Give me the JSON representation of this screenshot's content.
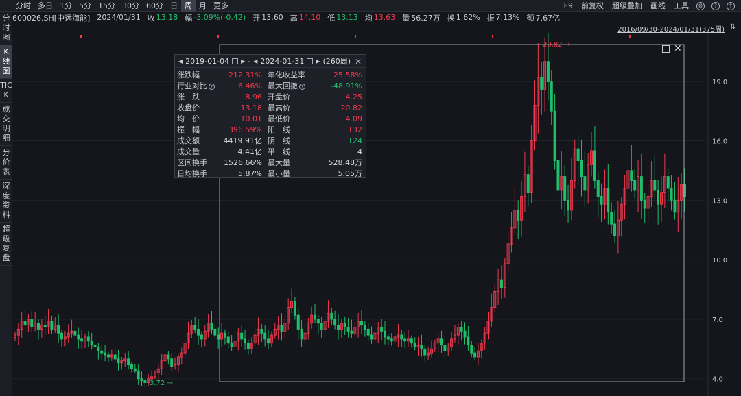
{
  "toolbar": {
    "periods": [
      "分时",
      "多日",
      "1分",
      "5分",
      "15分",
      "30分",
      "60分",
      "日",
      "周",
      "月",
      "更多"
    ],
    "active_period": "周",
    "right": [
      "F9",
      "前复权",
      "超级叠加",
      "画线",
      "工具"
    ]
  },
  "sidebar": {
    "items": [
      "分时图",
      "K线图",
      "TICK",
      "成交明细",
      "分价表",
      "深度资料",
      "超级复盘"
    ],
    "active": "K线图"
  },
  "info": {
    "code": "600026.SH[中远海能]",
    "date": "2024/01/31",
    "close_label": "收",
    "close": "13.18",
    "change_label": "幅",
    "change": "-3.09%(-0.42)",
    "open_label": "开",
    "open": "13.60",
    "high_label": "高",
    "high": "14.10",
    "low_label": "低",
    "low": "13.13",
    "avg_label": "均",
    "avg": "13.63",
    "vol_label": "量",
    "vol": "56.27万",
    "turn_label": "换",
    "turn": "1.62%",
    "amp_label": "振",
    "amp": "7.13%",
    "amt_label": "额",
    "amt": "7.67亿"
  },
  "range_text": "2016/09/30-2024/01/31(375周)",
  "stats": {
    "start_date": "2019-01-04",
    "dash": "-",
    "end_date": "2024-01-31",
    "weeks": "(260周)",
    "rows": [
      {
        "k1": "涨跌幅",
        "v1": "212.31%",
        "c1": "up",
        "k2": "年化收益率",
        "v2": "25.58%",
        "c2": "up"
      },
      {
        "k1": "行业对比",
        "v1": "6.46%",
        "c1": "up",
        "k2": "最大回撤",
        "v2": "-48.91%",
        "c2": "down",
        "h1": true,
        "h2": true
      },
      {
        "k1": "涨　跌",
        "v1": "8.96",
        "c1": "up",
        "k2": "开盘价",
        "v2": "4.25",
        "c2": "up"
      },
      {
        "k1": "收盘价",
        "v1": "13.18",
        "c1": "up",
        "k2": "最高价",
        "v2": "20.82",
        "c2": "up"
      },
      {
        "k1": "均　价",
        "v1": "10.01",
        "c1": "up",
        "k2": "最低价",
        "v2": "4.09",
        "c2": "up"
      },
      {
        "k1": "振　幅",
        "v1": "396.59%",
        "c1": "up",
        "k2": "阳　线",
        "v2": "132",
        "c2": "up"
      },
      {
        "k1": "成交额",
        "v1": "4419.91亿",
        "c1": "neutral",
        "k2": "阴　线",
        "v2": "124",
        "c2": "down"
      },
      {
        "k1": "成交量",
        "v1": "4.41亿",
        "c1": "neutral",
        "k2": "平　线",
        "v2": "4",
        "c2": "neutral"
      },
      {
        "k1": "区间换手",
        "v1": "1526.66%",
        "c1": "neutral",
        "k2": "最大量",
        "v2": "528.48万",
        "c2": "neutral"
      },
      {
        "k1": "日均换手",
        "v1": "5.87%",
        "c1": "neutral",
        "k2": "最小量",
        "v2": "5.05万",
        "c2": "neutral"
      }
    ]
  },
  "colors": {
    "up": "#f0394f",
    "down": "#1fbf6c",
    "bg": "#14161b"
  },
  "chart_data": {
    "type": "candlestick",
    "y_ticks": [
      "19.0",
      "16.0",
      "13.0",
      "10.0",
      "7.0",
      "4.0"
    ],
    "ylim": [
      3.3,
      21.1
    ],
    "high_marker": "20.82",
    "low_marker": "3.72",
    "close_path": [
      6.2,
      6.5,
      6.9,
      6.7,
      7.0,
      6.6,
      6.8,
      6.5,
      6.7,
      6.6,
      6.9,
      6.5,
      6.7,
      6.3,
      6.0,
      6.1,
      6.3,
      6.4,
      6.2,
      6.0,
      5.9,
      6.1,
      5.9,
      5.7,
      5.6,
      5.4,
      5.3,
      5.2,
      5.1,
      5.2,
      5.0,
      4.8,
      4.9,
      5.0,
      4.7,
      4.5,
      4.4,
      4.0,
      3.9,
      3.8,
      4.0,
      4.1,
      4.3,
      4.5,
      4.9,
      5.2,
      5.0,
      4.6,
      4.7,
      5.1,
      5.3,
      5.8,
      6.3,
      6.7,
      6.5,
      6.2,
      6.0,
      6.4,
      6.8,
      6.5,
      6.2,
      6.0,
      6.3,
      6.1,
      5.8,
      5.6,
      5.9,
      6.3,
      6.0,
      5.8,
      5.5,
      5.8,
      6.2,
      6.5,
      6.3,
      6.0,
      5.8,
      6.2,
      6.5,
      6.7,
      6.4,
      6.8,
      7.6,
      7.9,
      7.2,
      6.5,
      6.0,
      6.3,
      6.8,
      7.2,
      7.0,
      6.8,
      6.5,
      6.9,
      7.3,
      7.0,
      6.7,
      6.5,
      6.8,
      6.6,
      6.4,
      6.3,
      6.6,
      6.9,
      6.7,
      6.5,
      6.2,
      6.0,
      6.3,
      6.6,
      6.4,
      6.1,
      6.0,
      5.9,
      6.1,
      6.2,
      6.0,
      5.9,
      6.0,
      5.8,
      5.6,
      5.7,
      5.5,
      5.2,
      5.3,
      5.5,
      5.8,
      6.0,
      5.7,
      5.4,
      5.6,
      6.0,
      6.2,
      6.6,
      6.4,
      6.1,
      5.7,
      5.3,
      5.1,
      5.4,
      5.8,
      6.3,
      6.9,
      7.6,
      8.4,
      9.0,
      8.6,
      9.8,
      10.8,
      11.6,
      12.5,
      12.0,
      13.2,
      14.3,
      13.4,
      16.0,
      17.8,
      19.2,
      18.6,
      20.0,
      19.0,
      17.5,
      15.0,
      13.5,
      14.2,
      13.0,
      12.5,
      14.0,
      15.6,
      15.0,
      14.2,
      13.5,
      14.8,
      15.5,
      14.0,
      13.2,
      12.8,
      13.6,
      12.4,
      11.8,
      11.2,
      12.0,
      12.8,
      13.6,
      14.5,
      14.0,
      13.5,
      14.2,
      13.0,
      12.6,
      13.2,
      14.0,
      13.5,
      12.8,
      13.4,
      14.2,
      13.6,
      13.0,
      12.4,
      13.0,
      13.8,
      13.2
    ]
  }
}
